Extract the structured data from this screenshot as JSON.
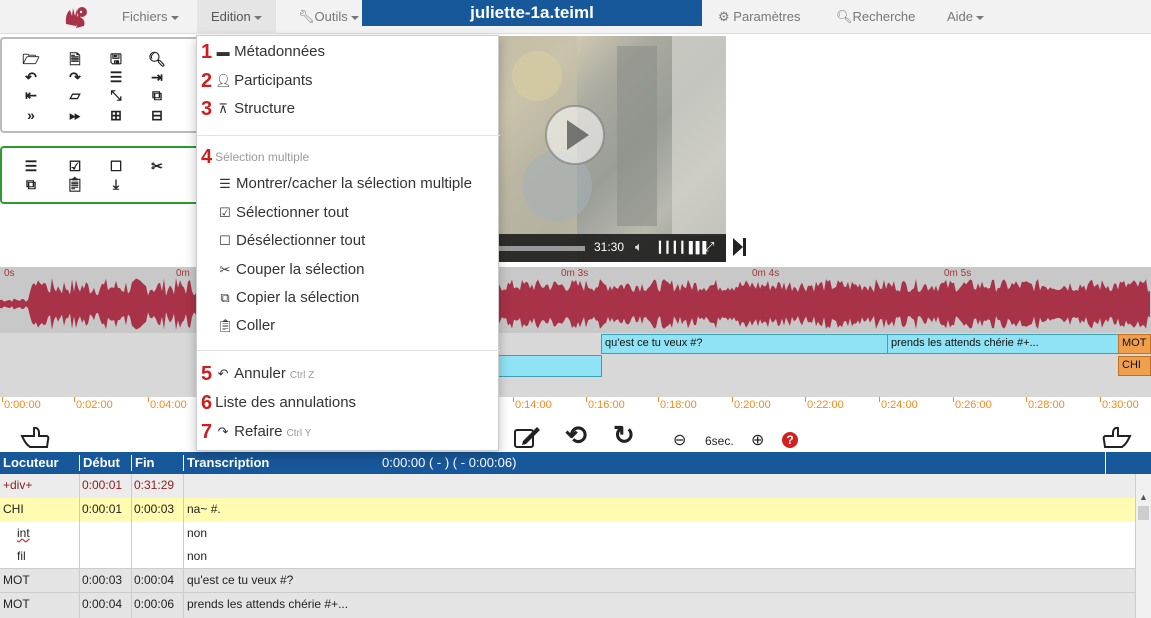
{
  "app": {
    "file_title": "juliette-1a.teiml"
  },
  "navbar": {
    "fichiers": "Fichiers",
    "edition": "Edition",
    "outils": "Outils",
    "parametres": "Paramètres",
    "recherche": "Recherche",
    "aide": "Aide"
  },
  "video": {
    "time": "31:30"
  },
  "edition_menu": {
    "items": [
      {
        "num": "1",
        "label": "Métadonnées"
      },
      {
        "num": "2",
        "label": "Participants"
      },
      {
        "num": "3",
        "label": "Structure"
      }
    ],
    "section_num": "4",
    "section_header": "Sélection multiple",
    "selection_items": [
      {
        "label": "Montrer/cacher la sélection multiple"
      },
      {
        "label": "Sélectionner tout"
      },
      {
        "label": "Désélectionner tout"
      },
      {
        "label": "Couper la sélection"
      },
      {
        "label": "Copier la sélection"
      },
      {
        "label": "Coller"
      }
    ],
    "undo_num": "5",
    "undo_label": "Annuler",
    "undo_shortcut": "Ctrl Z",
    "undo_list_num": "6",
    "undo_list_label": "Liste des annulations",
    "redo_num": "7",
    "redo_label": "Refaire",
    "redo_shortcut": "Ctrl Y"
  },
  "waveform": {
    "ruler": [
      "0s",
      "0m",
      "0m 3s",
      "0m 4s",
      "0m 5s"
    ]
  },
  "segments": {
    "s1": "qu'est ce tu veux #?",
    "s2": "prends les attends chérie #+...",
    "s3": "MOT",
    "s4": "CHI"
  },
  "timeline": {
    "ticks": [
      "0:00:00",
      "0:02:00",
      "0:04:00",
      "0:14:00",
      "0:16:00",
      "0:18:00",
      "0:20:00",
      "0:22:00",
      "0:24:00",
      "0:26:00",
      "0:28:00",
      "0:30:00"
    ]
  },
  "zoom": {
    "label": "6sec."
  },
  "table": {
    "headers": {
      "locuteur": "Locuteur",
      "debut": "Début",
      "fin": "Fin",
      "transcription": "Transcription",
      "timeinfo": "0:00:00 ( - )  ( - 0:00:06)"
    },
    "rows": [
      {
        "loc": "+div+",
        "debut": "0:00:01",
        "fin": "0:31:29",
        "text": ""
      },
      {
        "loc": "CHI",
        "debut": "0:00:01",
        "fin": "0:00:03",
        "text": "na~ #."
      },
      {
        "loc": "int",
        "debut": "",
        "fin": "",
        "text": "non"
      },
      {
        "loc": "fil",
        "debut": "",
        "fin": "",
        "text": "non"
      },
      {
        "loc": "MOT",
        "debut": "0:00:03",
        "fin": "0:00:04",
        "text": "qu'est ce tu veux #?"
      },
      {
        "loc": "MOT",
        "debut": "0:00:04",
        "fin": "0:00:06",
        "text": "prends les attends chérie #+..."
      }
    ]
  },
  "colors": {
    "brand_blue": "#17589b",
    "accent_red": "#cc1f1f",
    "wave_red": "#a83248",
    "segment_cyan": "#8fe3f4",
    "segment_orange": "#f0a04c",
    "timeline_orange": "#f08a20"
  }
}
